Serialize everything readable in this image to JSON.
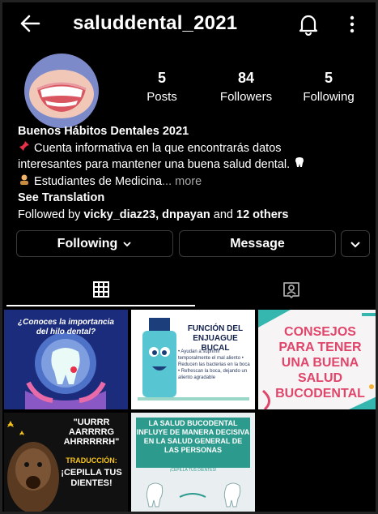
{
  "header": {
    "username": "saluddental_2021"
  },
  "profile": {
    "stats": [
      {
        "value": "5",
        "label": "Posts"
      },
      {
        "value": "84",
        "label": "Followers"
      },
      {
        "value": "5",
        "label": "Following"
      }
    ],
    "bio": {
      "name": "Buenos Hábitos Dentales 2021",
      "line1": "Cuenta informativa en la que encontrarás datos",
      "line2": "interesantes para mantener una buena salud dental.",
      "line3": "Estudiantes de Medicina",
      "more": "... more",
      "see_translation": "See Translation",
      "followed_by_prefix": "Followed by ",
      "followed_by_names": "vicky_diaz23, dnpayan",
      "followed_by_and": " and ",
      "followed_by_others": "12 others"
    }
  },
  "actions": {
    "following": "Following",
    "message": "Message"
  },
  "posts": [
    {
      "text": "¿Conoces la importancia del hilo dental?"
    },
    {
      "title": "FUNCIÓN DEL ENJUAGUE BUCAL",
      "body": "• Ayudan a suprimir temporalmente el mal aliento  • Reducen las bacterias en la boca  • Refrescan la boca, dejando un aliento agradable"
    },
    {
      "text": "CONSEJOS PARA TENER UNA BUENA SALUD BUCODENTAL"
    },
    {
      "quote": "\"UURRR AARRRRG AHRRRRRH\"",
      "label": "TRADUCCIÓN:",
      "translation": "¡CEPILLA TUS DIENTES!"
    },
    {
      "text": "LA SALUD BUCODENTAL INFLUYE DE MANERA DECISIVA EN LA SALUD GENERAL DE LAS PERSONAS",
      "sub": "¡CEPILLA TUS DIENTES!"
    }
  ],
  "icons": {
    "back": "arrow-left-icon",
    "bell": "bell-icon",
    "menu": "more-vertical-icon",
    "grid": "grid-icon",
    "tagged": "tagged-person-icon"
  },
  "colors": {
    "background": "#000000",
    "avatar_bg": "#7d8ac9",
    "post3_text": "#e0456a",
    "post5_band": "#2c9a8c"
  }
}
